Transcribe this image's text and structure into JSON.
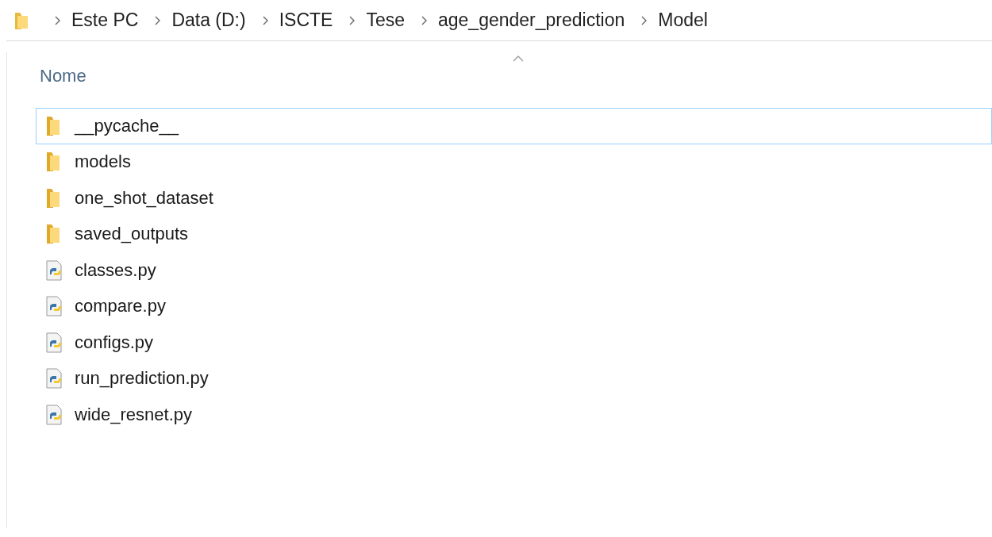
{
  "breadcrumb": [
    "Este PC",
    "Data (D:)",
    "ISCTE",
    "Tese",
    "age_gender_prediction",
    "Model"
  ],
  "column": {
    "label": "Nome",
    "sorted_ascending": true
  },
  "files": [
    {
      "name": "__pycache__",
      "kind": "folder",
      "selected": true
    },
    {
      "name": "models",
      "kind": "folder",
      "selected": false
    },
    {
      "name": "one_shot_dataset",
      "kind": "folder",
      "selected": false
    },
    {
      "name": "saved_outputs",
      "kind": "folder",
      "selected": false
    },
    {
      "name": "classes.py",
      "kind": "python",
      "selected": false
    },
    {
      "name": "compare.py",
      "kind": "python",
      "selected": false
    },
    {
      "name": "configs.py",
      "kind": "python",
      "selected": false
    },
    {
      "name": "run_prediction.py",
      "kind": "python",
      "selected": false
    },
    {
      "name": "wide_resnet.py",
      "kind": "python",
      "selected": false
    }
  ]
}
